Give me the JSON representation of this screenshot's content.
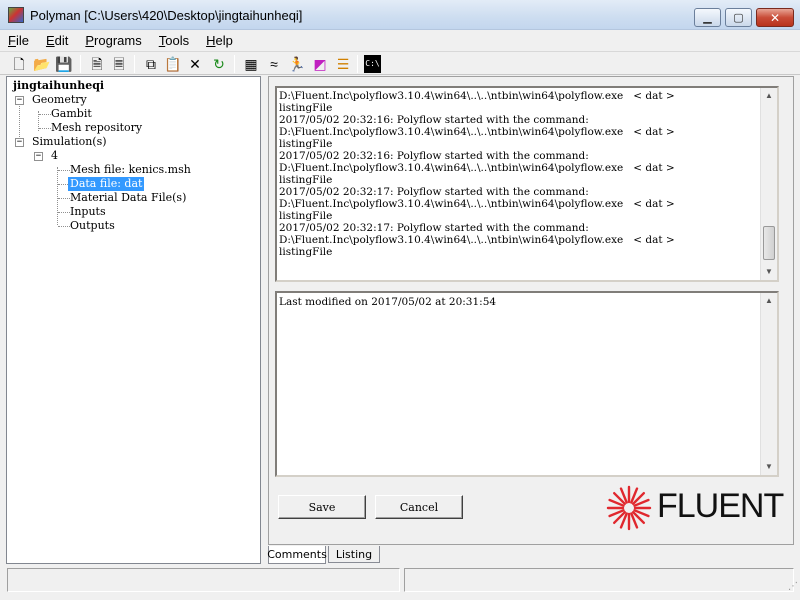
{
  "window": {
    "title": "Polyman [C:\\Users\\420\\Desktop\\jingtaihunheqi]",
    "min_glyph": "▁",
    "max_glyph": "▢",
    "close_glyph": "✕"
  },
  "menu": [
    {
      "key": "F",
      "rest": "ile"
    },
    {
      "key": "E",
      "rest": "dit"
    },
    {
      "key": "P",
      "rest": "rograms"
    },
    {
      "key": "T",
      "rest": "ools"
    },
    {
      "key": "H",
      "rest": "elp"
    }
  ],
  "toolbar": {
    "icons": [
      "new-icon",
      "open-folder-icon",
      "save-icon",
      "new-doc-icon",
      "doc-icon",
      "copy-icon",
      "paste-icon",
      "delete-icon",
      "refresh-icon",
      "grid-mesh-icon",
      "gambit-icon",
      "run-icon",
      "fieldview-icon",
      "polystat-icon",
      "command-prompt-icon"
    ],
    "glyphs": {
      "new": "🗋",
      "open": "📂",
      "save": "💾",
      "newdoc": "🗎",
      "doc": "🗏",
      "copy": "⧉",
      "paste": "📋",
      "delete": "✕",
      "refresh": "↻",
      "mesh": "▦",
      "gambit": "≈",
      "run": "🏃",
      "field": "◩",
      "polystat": "☰",
      "cmd": "C:\\"
    }
  },
  "tree": {
    "root": "jingtaihunheqi",
    "geometry": "Geometry",
    "gambit": "Gambit",
    "mesh_repository": "Mesh repository",
    "simulations": "Simulation(s)",
    "sim_4": "4",
    "mesh_file": "Mesh file: kenics.msh",
    "data_file": "Data file: dat",
    "material_data": "Material Data File(s)",
    "inputs": "Inputs",
    "outputs": "Outputs",
    "minus": "−"
  },
  "log": {
    "text": "D:\\Fluent.Inc\\polyflow3.10.4\\win64\\..\\..\\ntbin\\win64\\polyflow.exe   < dat >\nlistingFile\n2017/05/02 20:32:16: Polyflow started with the command:\nD:\\Fluent.Inc\\polyflow3.10.4\\win64\\..\\..\\ntbin\\win64\\polyflow.exe   < dat >\nlistingFile\n2017/05/02 20:32:16: Polyflow started with the command:\nD:\\Fluent.Inc\\polyflow3.10.4\\win64\\..\\..\\ntbin\\win64\\polyflow.exe   < dat >\nlistingFile\n2017/05/02 20:32:17: Polyflow started with the command:\nD:\\Fluent.Inc\\polyflow3.10.4\\win64\\..\\..\\ntbin\\win64\\polyflow.exe   < dat >\nlistingFile\n2017/05/02 20:32:17: Polyflow started with the command:\nD:\\Fluent.Inc\\polyflow3.10.4\\win64\\..\\..\\ntbin\\win64\\polyflow.exe   < dat >\nlistingFile"
  },
  "comments": {
    "text": "Last modified on 2017/05/02 at 20:31:54"
  },
  "buttons": {
    "save": "Save",
    "cancel": "Cancel"
  },
  "logo": {
    "text": "FLUENT",
    "color": "#e0282e"
  },
  "tabs": {
    "comments": "Comments",
    "listing": "Listing",
    "active": "Comments"
  },
  "scroll": {
    "up": "▲",
    "down": "▼"
  }
}
